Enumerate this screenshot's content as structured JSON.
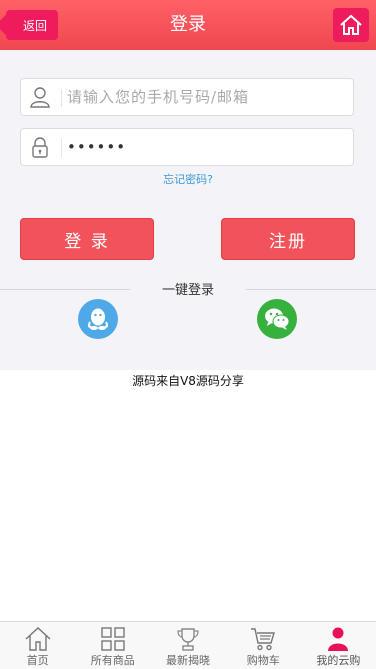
{
  "header": {
    "back_label": "返回",
    "title": "登录",
    "home_icon": "home-icon"
  },
  "login": {
    "account_placeholder": "请输入您的手机号码/邮箱",
    "account_value": "",
    "password_value": "••••••",
    "forgot_label": "忘记密码?",
    "login_label": "登 录",
    "register_label": "注册"
  },
  "social": {
    "divider_label": "一键登录",
    "qq_icon": "qq-icon",
    "wechat_icon": "wechat-icon",
    "qq_color": "#4fa9e8",
    "wechat_color": "#36b13d"
  },
  "footer_note": "源码来自V8源码分享",
  "tabs": [
    {
      "label": "首页",
      "icon": "home-icon"
    },
    {
      "label": "所有商品",
      "icon": "grid-icon"
    },
    {
      "label": "最新揭晓",
      "icon": "trophy-icon"
    },
    {
      "label": "购物车",
      "icon": "cart-icon"
    },
    {
      "label": "我的云购",
      "icon": "user-icon",
      "active": true
    }
  ],
  "colors": {
    "header": "#f0464f",
    "accent": "#ee1c5d",
    "button": "#f2535a",
    "link": "#3a9bd9"
  }
}
